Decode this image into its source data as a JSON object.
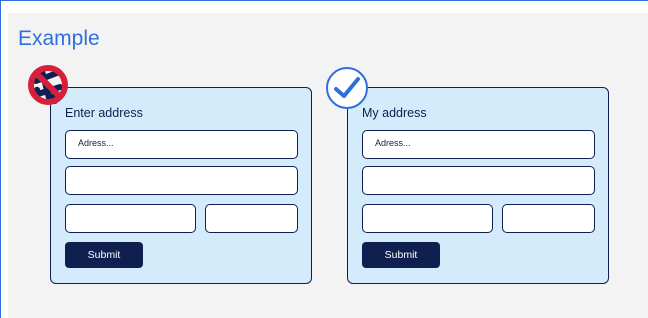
{
  "title": "Example",
  "icons": {
    "bad": "not-allowed-icon",
    "good": "checkmark-icon"
  },
  "colors": {
    "accent": "#2f6fdc",
    "card_bg": "#d3ebfa",
    "navy": "#0f2050",
    "bad_red": "#d61f3b"
  },
  "forms": [
    {
      "title": "Enter address",
      "address_placeholder": "Adress...",
      "submit_label": "Submit"
    },
    {
      "title": "My address",
      "address_placeholder": "Adress...",
      "submit_label": "Submit"
    }
  ]
}
